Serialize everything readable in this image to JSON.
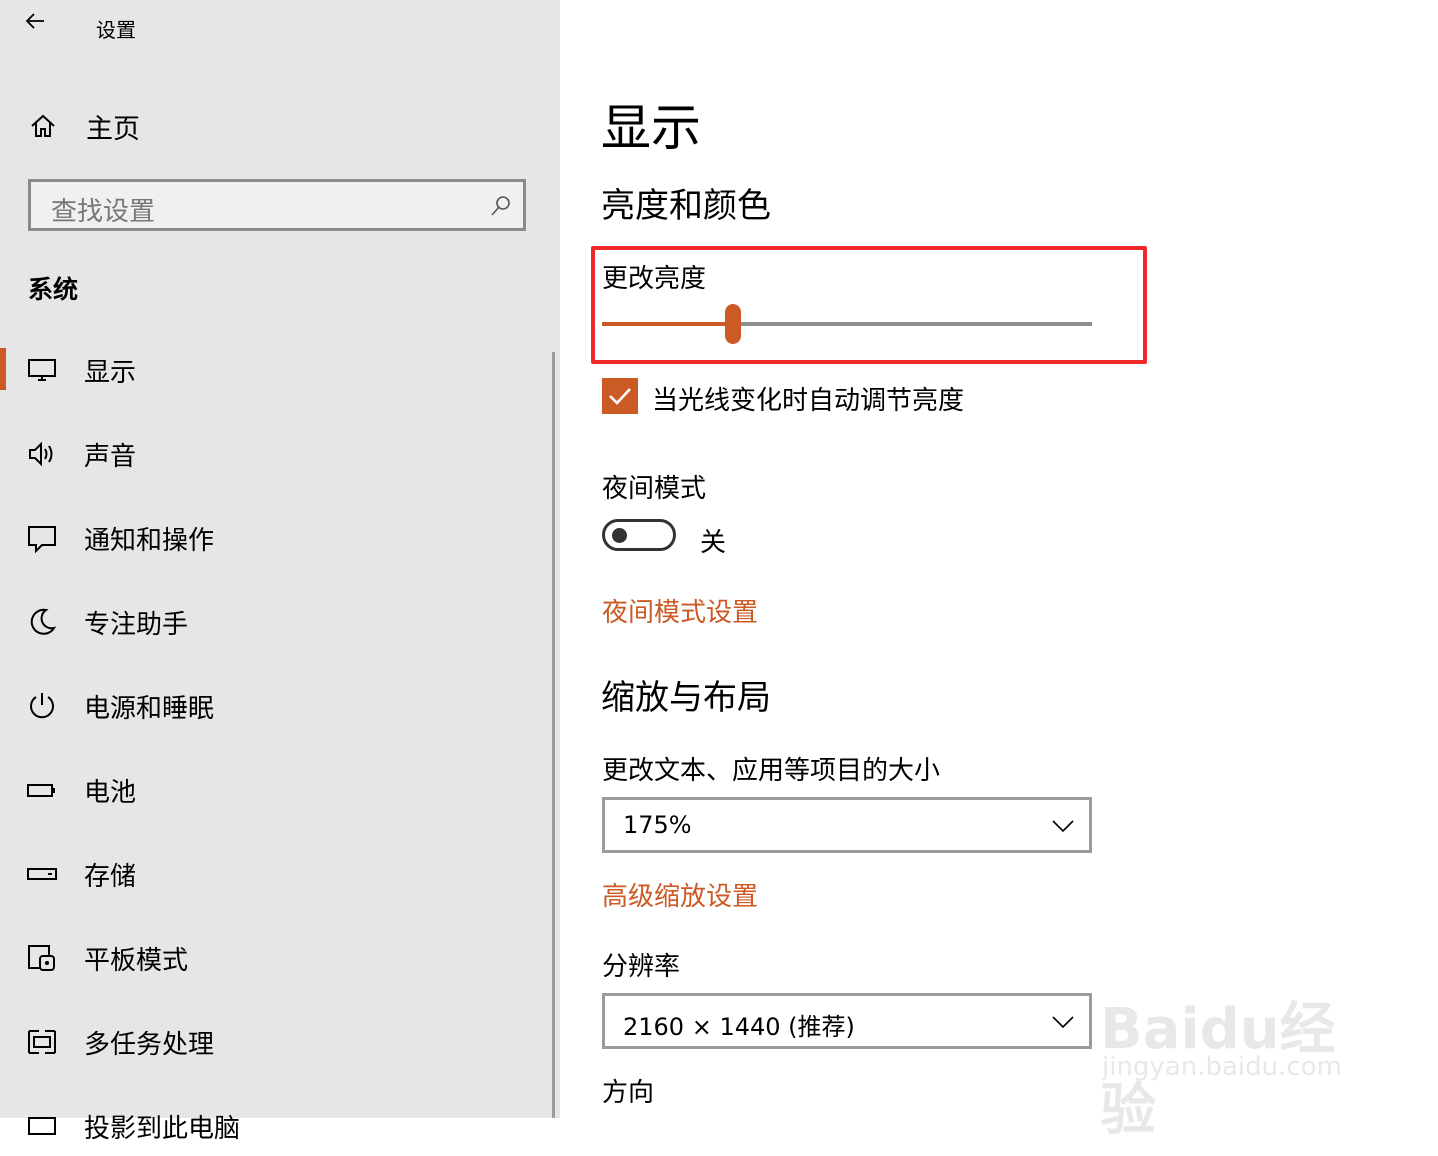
{
  "window": {
    "title": "设置"
  },
  "sidebar": {
    "home_label": "主页",
    "search_placeholder": "查找设置",
    "section_title": "系统",
    "items": [
      {
        "label": "显示",
        "icon": "monitor-icon",
        "active": true
      },
      {
        "label": "声音",
        "icon": "speaker-icon",
        "active": false
      },
      {
        "label": "通知和操作",
        "icon": "notification-icon",
        "active": false
      },
      {
        "label": "专注助手",
        "icon": "moon-icon",
        "active": false
      },
      {
        "label": "电源和睡眠",
        "icon": "power-icon",
        "active": false
      },
      {
        "label": "电池",
        "icon": "battery-icon",
        "active": false
      },
      {
        "label": "存储",
        "icon": "storage-icon",
        "active": false
      },
      {
        "label": "平板模式",
        "icon": "tablet-icon",
        "active": false
      },
      {
        "label": "多任务处理",
        "icon": "multitask-icon",
        "active": false
      },
      {
        "label": "投影到此电脑",
        "icon": "project-icon",
        "active": false
      }
    ]
  },
  "main": {
    "page_title": "显示",
    "brightness_section": "亮度和颜色",
    "brightness_label": "更改亮度",
    "brightness_value": 0.26,
    "auto_brightness_label": "当光线变化时自动调节亮度",
    "auto_brightness_checked": true,
    "night_mode_label": "夜间模式",
    "night_mode_state": "关",
    "night_mode_settings_link": "夜间模式设置",
    "scale_section": "缩放与布局",
    "scale_label": "更改文本、应用等项目的大小",
    "scale_value": "175%",
    "advanced_scale_link": "高级缩放设置",
    "resolution_label": "分辨率",
    "resolution_value": "2160 × 1440 (推荐)",
    "orientation_label": "方向"
  },
  "watermark": {
    "text": "Baidu经验",
    "url": "jingyan.baidu.com"
  },
  "colors": {
    "accent": "#cc5a25",
    "highlight_box": "#f02a2a",
    "sidebar_bg": "#e6e6e6"
  }
}
